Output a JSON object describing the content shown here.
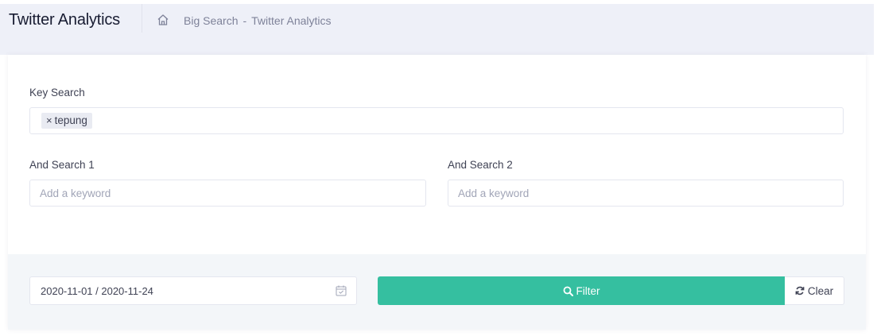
{
  "header": {
    "title": "Twitter Analytics",
    "breadcrumb": [
      "Big Search",
      "-",
      "Twitter Analytics"
    ]
  },
  "form": {
    "key_search": {
      "label": "Key Search",
      "tags": [
        {
          "remove_glyph": "×",
          "text": "tepung"
        }
      ]
    },
    "and_search_1": {
      "label": "And Search 1",
      "placeholder": "Add a keyword",
      "value": ""
    },
    "and_search_2": {
      "label": "And Search 2",
      "placeholder": "Add a keyword",
      "value": ""
    }
  },
  "footer": {
    "date_range": "2020-11-01 / 2020-11-24",
    "filter_label": "Filter",
    "clear_label": "Clear"
  },
  "colors": {
    "accent": "#35bfa0",
    "subheader_bg": "#eef0f8",
    "footer_bg": "#f3f6f9"
  },
  "icons": [
    "home-icon",
    "calendar-icon",
    "search-icon",
    "refresh-icon",
    "close-icon"
  ]
}
